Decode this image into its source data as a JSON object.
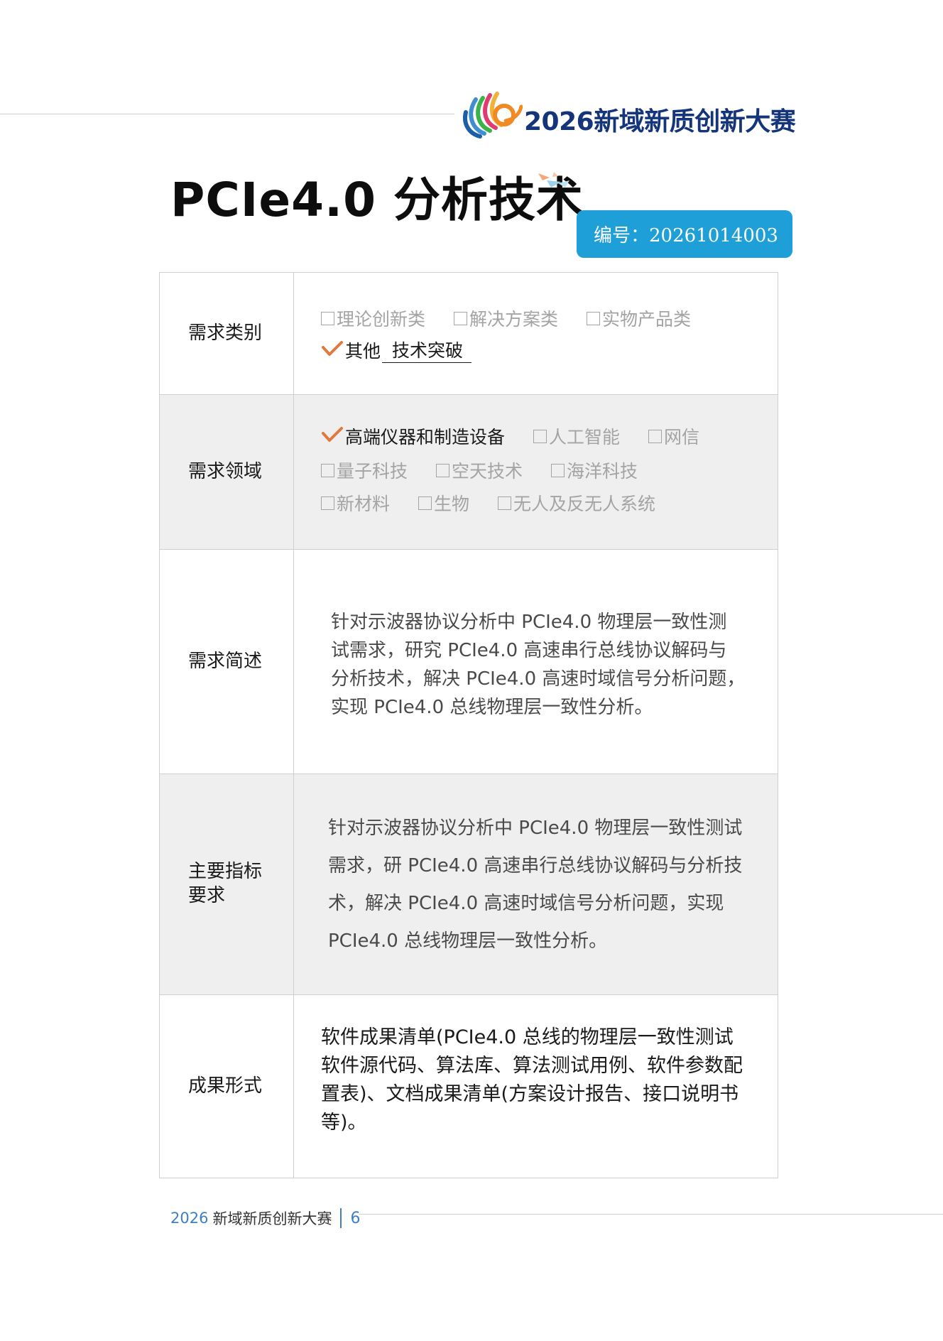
{
  "brand": {
    "name": "2026新域新质创新大赛"
  },
  "document": {
    "title": "PCIe4.0 分析技术",
    "code": "编号：20261014003"
  },
  "table": {
    "category": {
      "label": "需求类别",
      "options": [
        {
          "text": "理论创新类",
          "checked": false
        },
        {
          "text": "解决方案类",
          "checked": false
        },
        {
          "text": "实物产品类",
          "checked": false
        },
        {
          "text": "其他",
          "checked": true
        }
      ],
      "other_value": "技术突破"
    },
    "field": {
      "label": "需求领域",
      "options": [
        {
          "text": "高端仪器和制造设备",
          "checked": true
        },
        {
          "text": "人工智能",
          "checked": false
        },
        {
          "text": "网信",
          "checked": false
        },
        {
          "text": "量子科技",
          "checked": false
        },
        {
          "text": "空天技术",
          "checked": false
        },
        {
          "text": "海洋科技",
          "checked": false
        },
        {
          "text": "新材料",
          "checked": false
        },
        {
          "text": "生物",
          "checked": false
        },
        {
          "text": "无人及反无人系统",
          "checked": false
        }
      ]
    },
    "summary": {
      "label": "需求简述",
      "lines": [
        "针对示波器协议分析中 PCIe4.0 物理层一致性测",
        "试需求，研究  PCIe4.0 高速串行总线协议解码与",
        "分析技术，解决 PCIe4.0 高速时域信号分析问题，",
        "实现 PCIe4.0 总线物理层一致性分析。"
      ]
    },
    "indicators": {
      "label": "主要指标要求",
      "lines": [
        "针对示波器协议分析中 PCIe4.0 物理层一致性测试",
        "需求，研 PCIe4.0 高速串行总线协议解码与分析技",
        "术，解决 PCIe4.0 高速时域信号分析问题，实现",
        "PCIe4.0 总线物理层一致性分析。"
      ]
    },
    "deliverables": {
      "label": "成果形式",
      "lines": [
        "软件成果清单(PCIe4.0 总线的物理层一致性测试",
        "软件源代码、算法库、算法测试用例、软件参数配",
        "置表)、文档成果清单(方案设计报告、接口说明书",
        "等)。"
      ]
    }
  },
  "footer": {
    "year": "2026",
    "name": "新域新质创新大赛",
    "page": "6"
  },
  "colors": {
    "brand_blue": "#15357a",
    "badge_blue": "#1e9fd8",
    "check_orange": "#e07a3c",
    "row_alt_bg": "#efefef",
    "footer_blue": "#3e7fc4"
  }
}
